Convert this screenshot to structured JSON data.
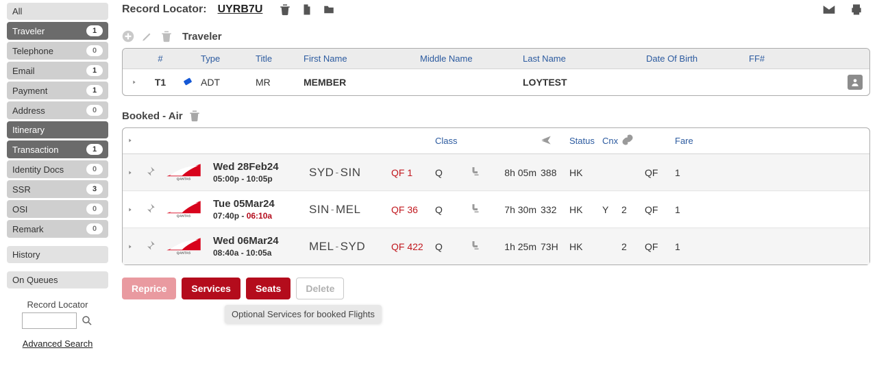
{
  "header": {
    "record_locator_label": "Record Locator:",
    "record_locator_value": "UYRB7U"
  },
  "sidebar": {
    "items": [
      {
        "label": "All",
        "count": null,
        "style": "light"
      },
      {
        "label": "Traveler",
        "count": "1",
        "style": "dark"
      },
      {
        "label": "Telephone",
        "count": "0",
        "style": "normal"
      },
      {
        "label": "Email",
        "count": "1",
        "style": "normal"
      },
      {
        "label": "Payment",
        "count": "1",
        "style": "normal"
      },
      {
        "label": "Address",
        "count": "0",
        "style": "normal"
      },
      {
        "label": "Itinerary",
        "count": null,
        "style": "dark"
      },
      {
        "label": "Transaction",
        "count": "1",
        "style": "dark"
      },
      {
        "label": "Identity Docs",
        "count": "0",
        "style": "normal"
      },
      {
        "label": "SSR",
        "count": "3",
        "style": "normal"
      },
      {
        "label": "OSI",
        "count": "0",
        "style": "normal"
      },
      {
        "label": "Remark",
        "count": "0",
        "style": "normal"
      },
      {
        "label": "History",
        "count": null,
        "style": "light",
        "spaced": true
      },
      {
        "label": "On Queues",
        "count": null,
        "style": "light",
        "spaced": true
      }
    ],
    "record_locator_label": "Record Locator",
    "advanced_search": "Advanced Search"
  },
  "traveler": {
    "section_title": "Traveler",
    "headers": {
      "num": "#",
      "type": "Type",
      "title": "Title",
      "first": "First Name",
      "middle": "Middle Name",
      "last": "Last Name",
      "dob": "Date Of Birth",
      "ff": "FF#"
    },
    "rows": [
      {
        "num": "T1",
        "type": "ADT",
        "title": "MR",
        "first": "MEMBER",
        "middle": "",
        "last": "LOYTEST",
        "dob": "",
        "ff": ""
      }
    ]
  },
  "booked_air": {
    "section_title": "Booked - Air",
    "headers": {
      "class": "Class",
      "status": "Status",
      "cnx": "Cnx",
      "fare": "Fare"
    },
    "segments": [
      {
        "date": "Wed 28Feb24",
        "times_a": "05:00p",
        "times_sep": " - ",
        "times_b": "10:05p",
        "times_b_red": false,
        "from": "SYD",
        "to": "SIN",
        "flight": "QF 1",
        "class": "Q",
        "duration": "8h 05m",
        "equip": "388",
        "status": "HK",
        "cnx": "",
        "fare_n": "",
        "fare_c": "QF",
        "fare_v": "1",
        "rowstyle": "grey"
      },
      {
        "date": "Tue 05Mar24",
        "times_a": "07:40p",
        "times_sep": " - ",
        "times_b": "06:10a",
        "times_b_red": true,
        "from": "SIN",
        "to": "MEL",
        "flight": "QF 36",
        "class": "Q",
        "duration": "7h 30m",
        "equip": "332",
        "status": "HK",
        "cnx": "Y",
        "fare_n": "2",
        "fare_c": "QF",
        "fare_v": "1",
        "rowstyle": "white"
      },
      {
        "date": "Wed 06Mar24",
        "times_a": "08:40a",
        "times_sep": " - ",
        "times_b": "10:05a",
        "times_b_red": false,
        "from": "MEL",
        "to": "SYD",
        "flight": "QF 422",
        "class": "Q",
        "duration": "1h 25m",
        "equip": "73H",
        "status": "HK",
        "cnx": "",
        "fare_n": "2",
        "fare_c": "QF",
        "fare_v": "1",
        "rowstyle": "grey"
      }
    ]
  },
  "actions": {
    "reprice": "Reprice",
    "services": "Services",
    "seats": "Seats",
    "delete": "Delete",
    "tooltip": "Optional Services for booked Flights"
  }
}
